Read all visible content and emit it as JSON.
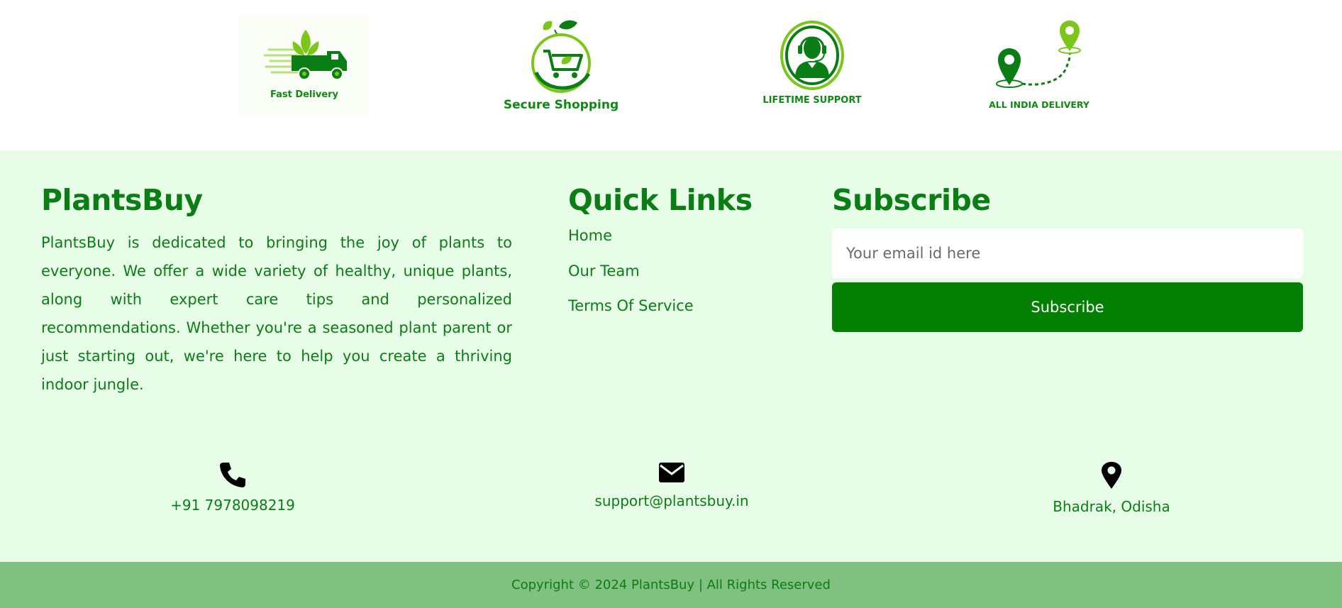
{
  "features": [
    {
      "label": "Fast Delivery",
      "icon": "delivery-truck-icon"
    },
    {
      "label": "Secure Shopping",
      "icon": "shopping-cart-leaf-icon"
    },
    {
      "label": "LIFETIME SUPPORT",
      "icon": "support-agent-icon"
    },
    {
      "label": "ALL INDIA DELIVERY",
      "icon": "location-route-icon"
    }
  ],
  "about": {
    "heading": "PlantsBuy",
    "text": "PlantsBuy is dedicated to bringing the joy of plants to everyone. We offer a wide variety of healthy, unique plants, along with expert care tips and personalized recommendations. Whether you're a seasoned plant parent or just starting out, we're here to help you create a thriving indoor jungle."
  },
  "quick_links": {
    "heading": "Quick Links",
    "items": [
      "Home",
      "Our Team",
      "Terms Of Service"
    ]
  },
  "subscribe": {
    "heading": "Subscribe",
    "placeholder": "Your email id here",
    "button_label": "Subscribe"
  },
  "contact": {
    "phone": "+91 7978098219",
    "email": "support@plantsbuy.in",
    "location": "Bhadrak, Odisha"
  },
  "copyright": "Copyright © 2024 PlantsBuy | All Rights Reserved",
  "colors": {
    "brand_green": "#0a7d14",
    "button_green": "#038004",
    "footer_bg": "#e8fde8",
    "copyright_bg": "#80c080",
    "light_green": "#7cc61a"
  }
}
